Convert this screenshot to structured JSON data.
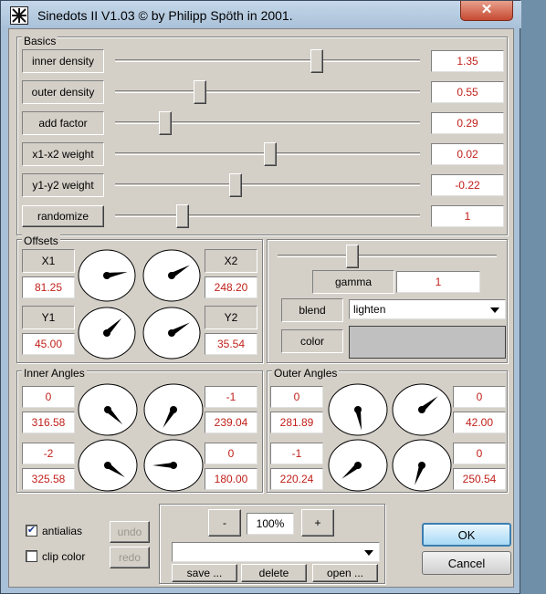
{
  "window": {
    "title": "Sinedots II V1.03 © by Philipp Spöth in 2001.",
    "close_label": "✕"
  },
  "basics": {
    "group_label": "Basics",
    "sliders": [
      {
        "label": "inner density",
        "value": "1.35",
        "position": 0.67
      },
      {
        "label": "outer density",
        "value": "0.55",
        "position": 0.27
      },
      {
        "label": "add factor",
        "value": "0.29",
        "position": 0.15
      },
      {
        "label": "x1-x2 weight",
        "value": "0.02",
        "position": 0.51
      },
      {
        "label": "y1-y2 weight",
        "value": "-0.22",
        "position": 0.39
      },
      {
        "label": "randomize",
        "value": "1",
        "position": 0.21
      }
    ]
  },
  "offsets": {
    "group_label": "Offsets",
    "x1": {
      "label": "X1",
      "value": "81.25"
    },
    "x2": {
      "label": "X2",
      "value": "248.20"
    },
    "y1": {
      "label": "Y1",
      "value": "45.00"
    },
    "y2": {
      "label": "Y2",
      "value": "35.54"
    },
    "dial_angles": [
      10,
      30,
      45,
      30
    ]
  },
  "render": {
    "gamma_label": "gamma",
    "gamma_value": "1",
    "gamma_position": 0.33,
    "blend_label": "blend",
    "blend_value": "lighten",
    "color_label": "color",
    "color_swatch": "#c0c0c0"
  },
  "inner_angles": {
    "group_label": "Inner Angles",
    "rows": [
      {
        "index": "0",
        "value": "316.58",
        "dial": -45
      },
      {
        "index": "-1",
        "value": "239.04",
        "dial": -120
      },
      {
        "index": "-2",
        "value": "325.58",
        "dial": -35
      },
      {
        "index": "0",
        "value": "180.00",
        "dial": 180
      }
    ]
  },
  "outer_angles": {
    "group_label": "Outer Angles",
    "rows": [
      {
        "index": "0",
        "value": "281.89",
        "dial": -80
      },
      {
        "index": "0",
        "value": "42.00",
        "dial": 40
      },
      {
        "index": "-1",
        "value": "220.24",
        "dial": -140
      },
      {
        "index": "0",
        "value": "250.54",
        "dial": -110
      }
    ]
  },
  "options": {
    "antialias_label": "antialias",
    "antialias_checked": true,
    "clip_color_label": "clip color",
    "clip_color_checked": false,
    "undo_label": "undo",
    "redo_label": "redo"
  },
  "presets": {
    "minus_label": "-",
    "zoom_value": "100%",
    "plus_label": "+",
    "preset_selected": "",
    "save_label": "save ...",
    "delete_label": "delete",
    "open_label": "open ..."
  },
  "dialog": {
    "ok_label": "OK",
    "cancel_label": "Cancel"
  },
  "colors": {
    "value_text": "#c0201a",
    "face": "#d4d0c8"
  }
}
